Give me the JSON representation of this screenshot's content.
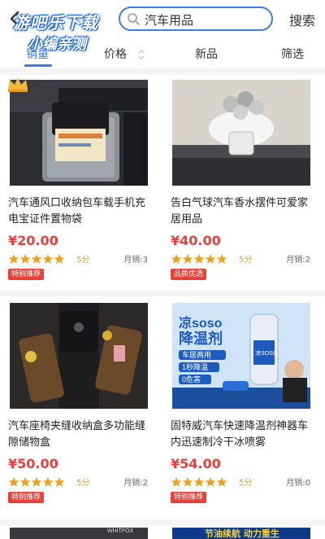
{
  "header": {
    "search_value": "汽车用品",
    "search_button": "搜索"
  },
  "watermark": {
    "line1": "游吧乐下载",
    "line2": "小编亲测"
  },
  "tabs": [
    {
      "label": "销量",
      "active": true
    },
    {
      "label": "价格",
      "active": false
    },
    {
      "label": "新品",
      "active": false
    },
    {
      "label": "筛选",
      "active": false
    }
  ],
  "products": [
    {
      "title": "汽车通风口收纳包车载手机充电宝证件置物袋",
      "price": "¥20.00",
      "rating": 5,
      "score": "5分",
      "monthly_sales": "月销:3",
      "badge": "特别推荐"
    },
    {
      "title": "告白气球汽车香水摆件可爱家居用品",
      "price": "¥40.00",
      "rating": 5,
      "score": "5分",
      "monthly_sales": "月销:2",
      "badge": "品质优选"
    },
    {
      "title": "汽车座椅夹缝收纳盒多功能缝隙储物盒",
      "price": "¥50.00",
      "rating": 5,
      "score": "5分",
      "monthly_sales": "月销:2",
      "badge": "特别推荐"
    },
    {
      "title": "固特威汽车快速降温剂神器车内迅速制冷干冰喷雾",
      "price": "¥54.00",
      "rating": 5,
      "score": "5分",
      "monthly_sales": "月销:0",
      "badge": "特别推荐",
      "image_text": {
        "brand": "凉soso",
        "product": "降温剂",
        "line1": "车居两用",
        "line2": "1秒降温",
        "line3": "0危害",
        "can_label": "凉SOSO"
      }
    }
  ],
  "bottom_banner": {
    "text": "节油续航 动力重生",
    "brand": "WHITFOX"
  },
  "colors": {
    "accent": "#3d7de6",
    "price": "#e8413a",
    "star": "#f0a020"
  }
}
